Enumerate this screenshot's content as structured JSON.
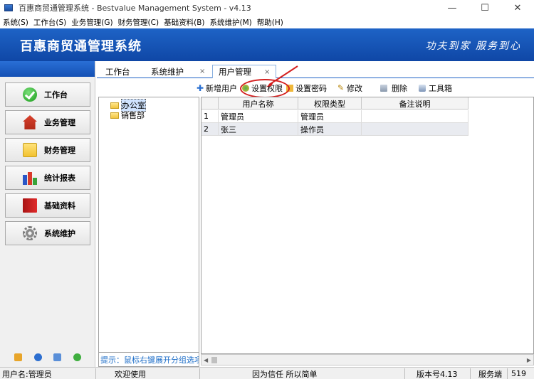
{
  "window": {
    "title": "百惠商贸通管理系统 - Bestvalue Management System - v4.13",
    "controls": [
      "—",
      "☐",
      "✕"
    ]
  },
  "menu": [
    "系统(S)",
    "工作台(S)",
    "业务管理(G)",
    "财务管理(C)",
    "基础资料(B)",
    "系统维护(M)",
    "帮助(H)"
  ],
  "banner": {
    "title": "百惠商贸通管理系统",
    "slogan": "功夫到家 服务到心"
  },
  "sidebar": {
    "items": [
      {
        "label": "工作台",
        "icon": "check-icon"
      },
      {
        "label": "业务管理",
        "icon": "house-icon"
      },
      {
        "label": "财务管理",
        "icon": "folder-icon"
      },
      {
        "label": "统计报表",
        "icon": "bar-chart-icon"
      },
      {
        "label": "基础资料",
        "icon": "book-icon"
      },
      {
        "label": "系统维护",
        "icon": "gear-icon"
      }
    ]
  },
  "tabs": [
    {
      "label": "工作台"
    },
    {
      "label": "系统维护",
      "close": "×"
    },
    {
      "label": "用户管理",
      "close": "×"
    }
  ],
  "toolbar": {
    "add_user": "新增用户",
    "set_permission": "设置权限",
    "set_password": "设置密码",
    "edit": "修改",
    "delete": "删除",
    "toolbox": "工具箱"
  },
  "tree": {
    "items": [
      "办公室",
      "销售部"
    ],
    "tip": "提示：鼠标右键展开分组选项"
  },
  "grid": {
    "columns": [
      "用户名称",
      "权限类型",
      "备注说明"
    ],
    "rows": [
      {
        "no": "1",
        "name": "管理员",
        "type": "管理员",
        "note": ""
      },
      {
        "no": "2",
        "name": "张三",
        "type": "操作员",
        "note": ""
      }
    ]
  },
  "status": {
    "user": "用户名:管理员",
    "welcome": "欢迎使用",
    "motto": "因为信任 所以简单",
    "version": "版本号4.13",
    "server_label": "服务端",
    "server_value": "519"
  }
}
